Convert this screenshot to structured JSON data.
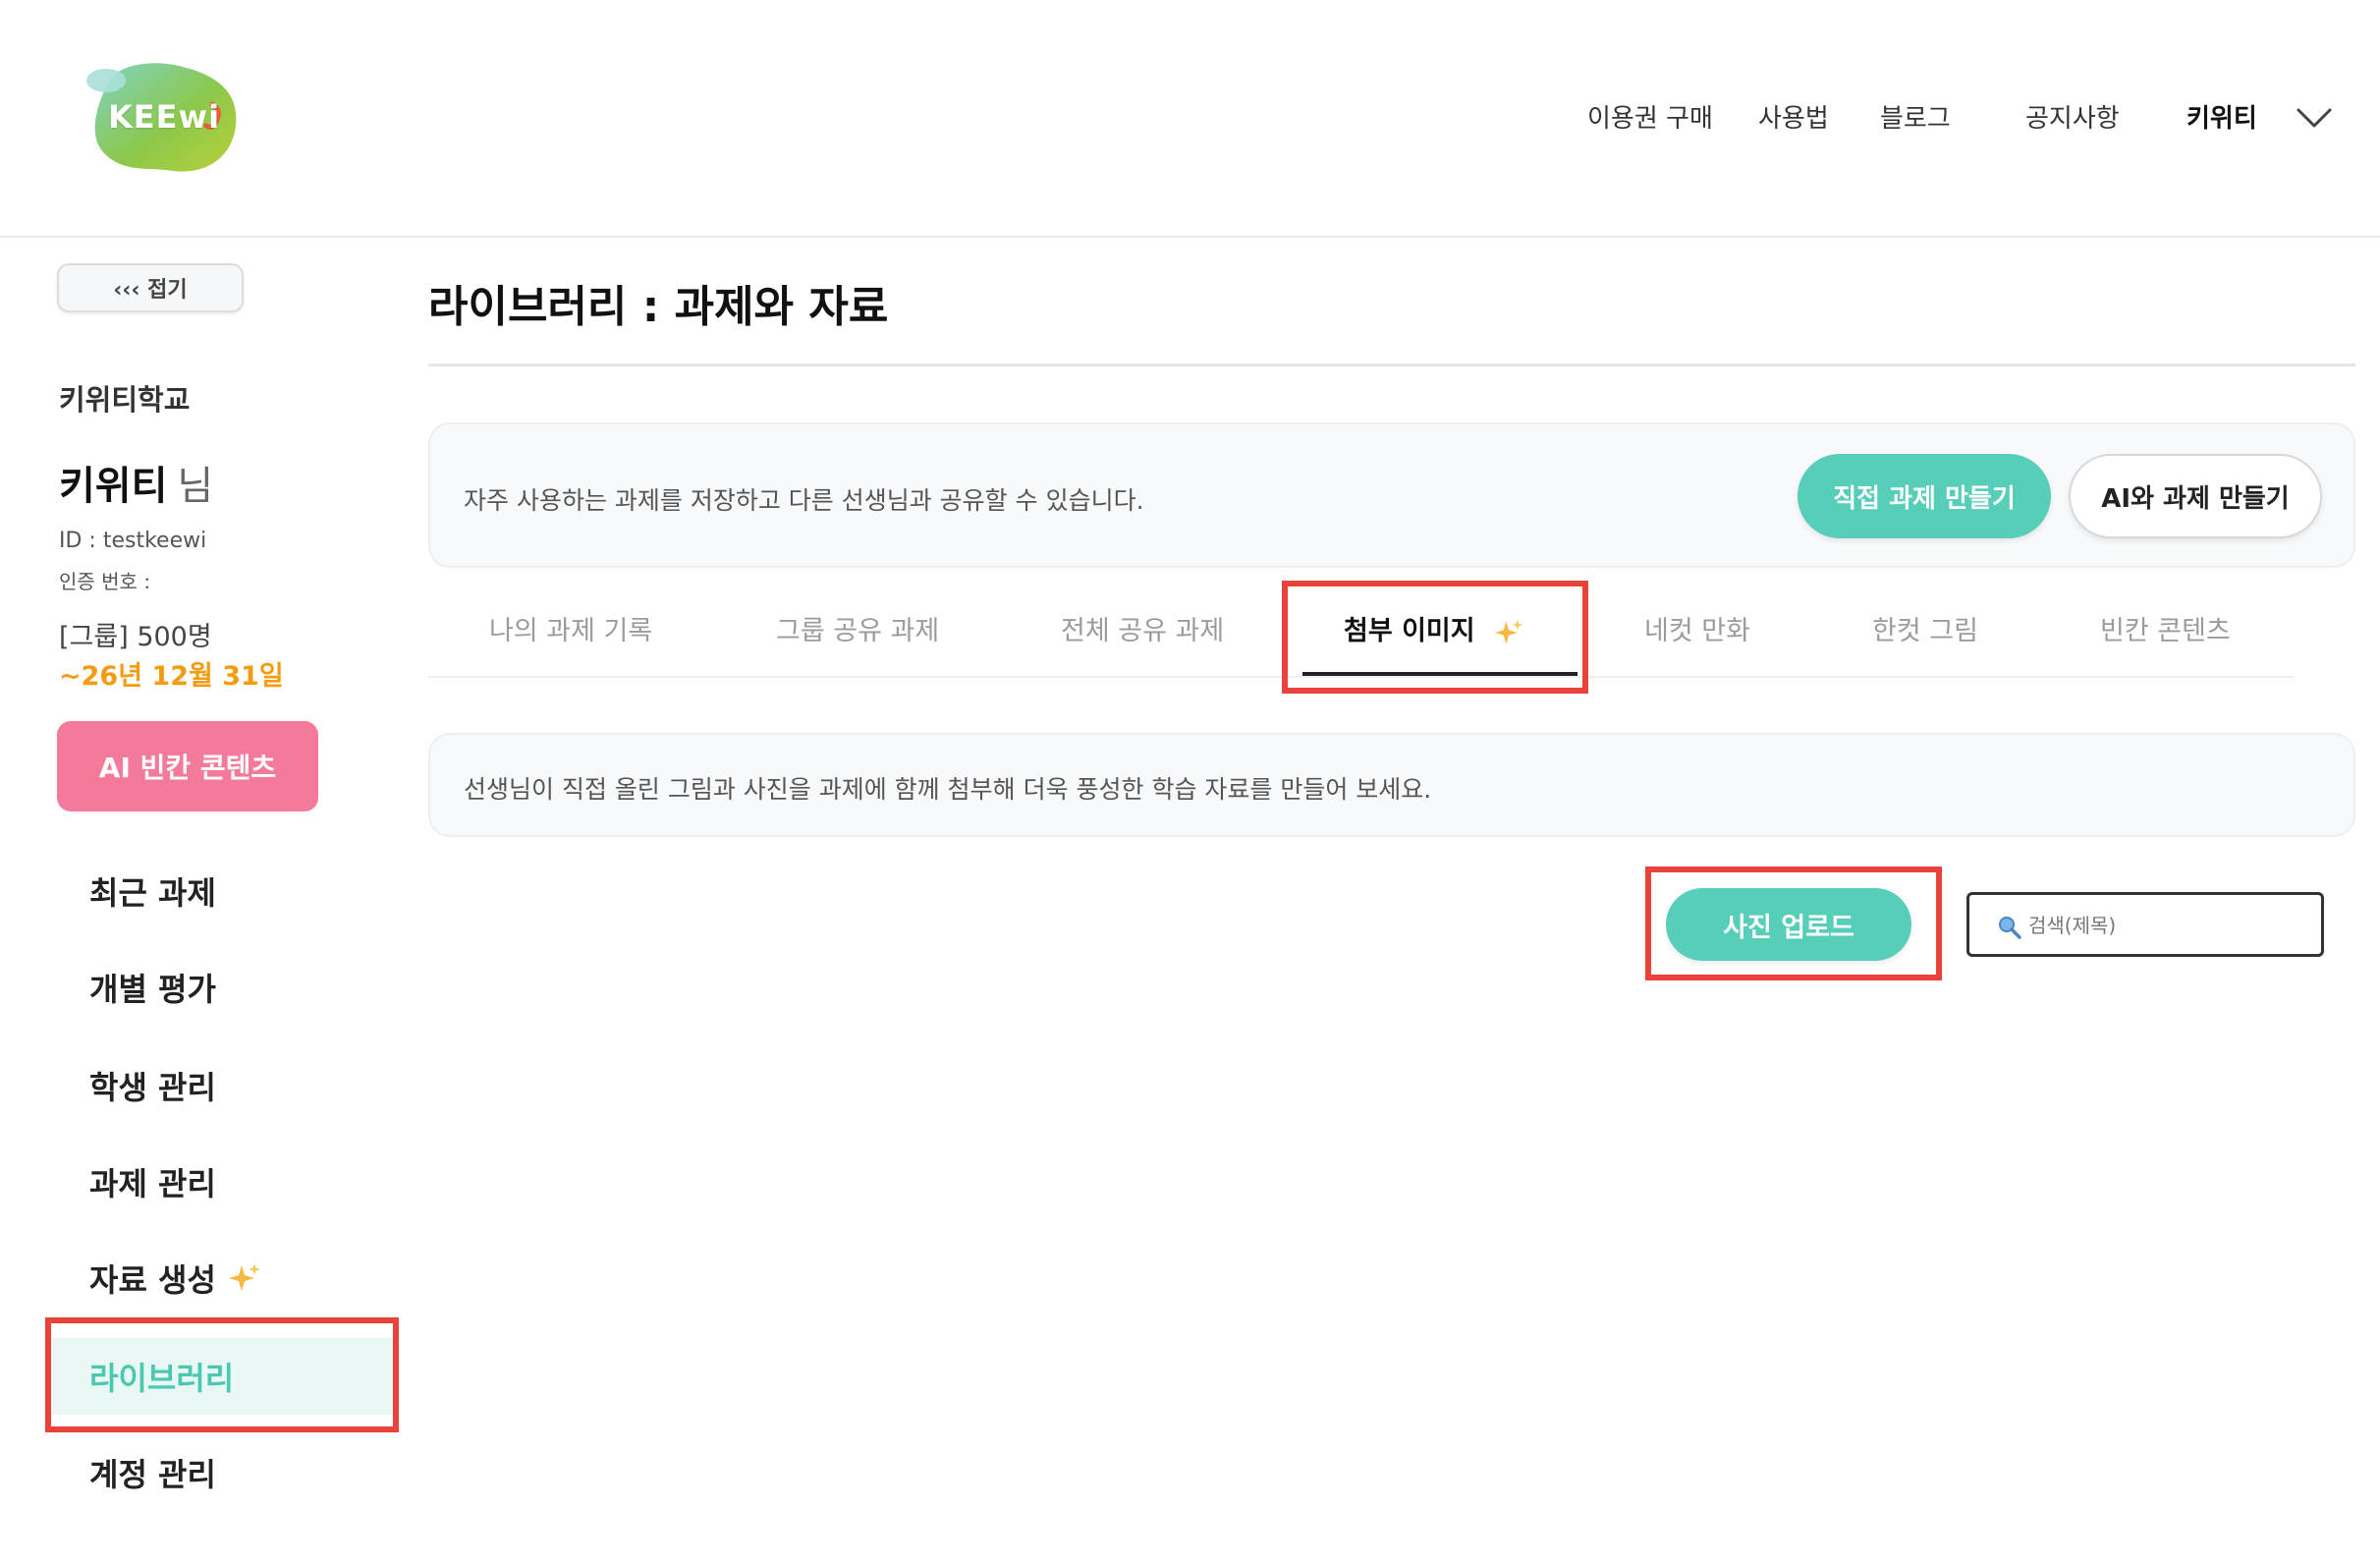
{
  "brand": {
    "logo_text": "KEEwi"
  },
  "header": {
    "nav": [
      "이용권 구매",
      "사용법",
      "블로그",
      "공지사항"
    ],
    "user_menu": "키위티"
  },
  "sidebar": {
    "collapse_label": "‹‹‹ 접기",
    "school": "키위티학교",
    "user_name": "키위티",
    "user_suffix": "님",
    "user_id": "ID : testkeewi",
    "auth_code": "인증 번호 : ",
    "plan": "[그룹] 500명",
    "expiry": "~26년 12월 31일",
    "ai_blank_button": "AI 빈칸 콘텐츠",
    "items": [
      {
        "label": "최근 과제"
      },
      {
        "label": "개별 평가"
      },
      {
        "label": "학생 관리"
      },
      {
        "label": "과제 관리"
      },
      {
        "label": "자료 생성"
      },
      {
        "label": "라이브러리"
      },
      {
        "label": "계정 관리"
      }
    ]
  },
  "main": {
    "title": "라이브러리 : 과제와 자료",
    "info_text": "자주 사용하는 과제를 저장하고 다른 선생님과 공유할 수 있습니다.",
    "btn_direct": "직접 과제 만들기",
    "btn_ai": "AI와 과제 만들기",
    "tabs": [
      {
        "label": "나의 과제 기록"
      },
      {
        "label": "그룹 공유 과제"
      },
      {
        "label": "전체 공유 과제"
      },
      {
        "label": "첨부 이미지"
      },
      {
        "label": "네컷 만화"
      },
      {
        "label": "한컷 그림"
      },
      {
        "label": "빈칸 콘텐츠"
      }
    ],
    "active_tab": "첨부 이미지",
    "hint_text": "선생님이 직접 올린 그림과 사진을 과제에 함께 첨부해 더욱 풍성한 학습 자료를 만들어 보세요.",
    "upload_button": "사진 업로드",
    "search_placeholder": "검색(제목)"
  },
  "colors": {
    "accent": "#57cfb8",
    "pink": "#f37a9b",
    "orange": "#f39c12",
    "highlight": "#e8423a"
  }
}
